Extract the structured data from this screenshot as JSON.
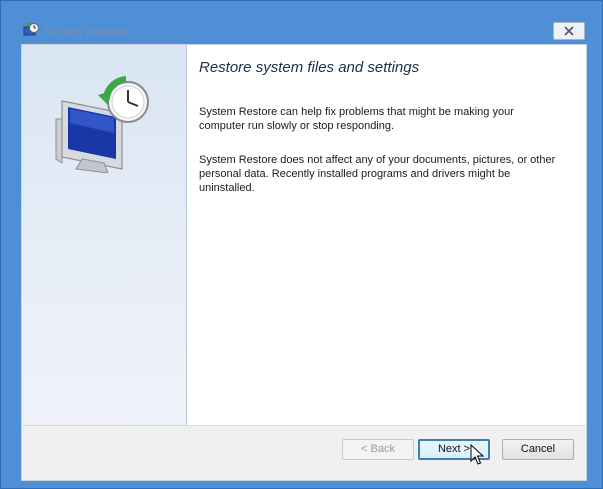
{
  "window": {
    "title": "System Restore",
    "close_icon": "close-icon"
  },
  "content": {
    "heading": "Restore system files and settings",
    "paragraph1": "System Restore can help fix problems that might be making your computer run slowly or stop responding.",
    "paragraph2": "System Restore does not affect any of your documents, pictures, or other personal data. Recently installed programs and drivers might be uninstalled."
  },
  "buttons": {
    "back": "< Back",
    "next": "Next >",
    "cancel": "Cancel"
  },
  "colors": {
    "window_frame": "#4f8fd6",
    "side_panel": "#d9e5f3",
    "default_button_border": "#3c7fb1"
  },
  "icons": {
    "title": "system-restore-icon",
    "illustration": "monitor-clock-restore-icon",
    "cursor": "mouse-pointer-icon"
  }
}
